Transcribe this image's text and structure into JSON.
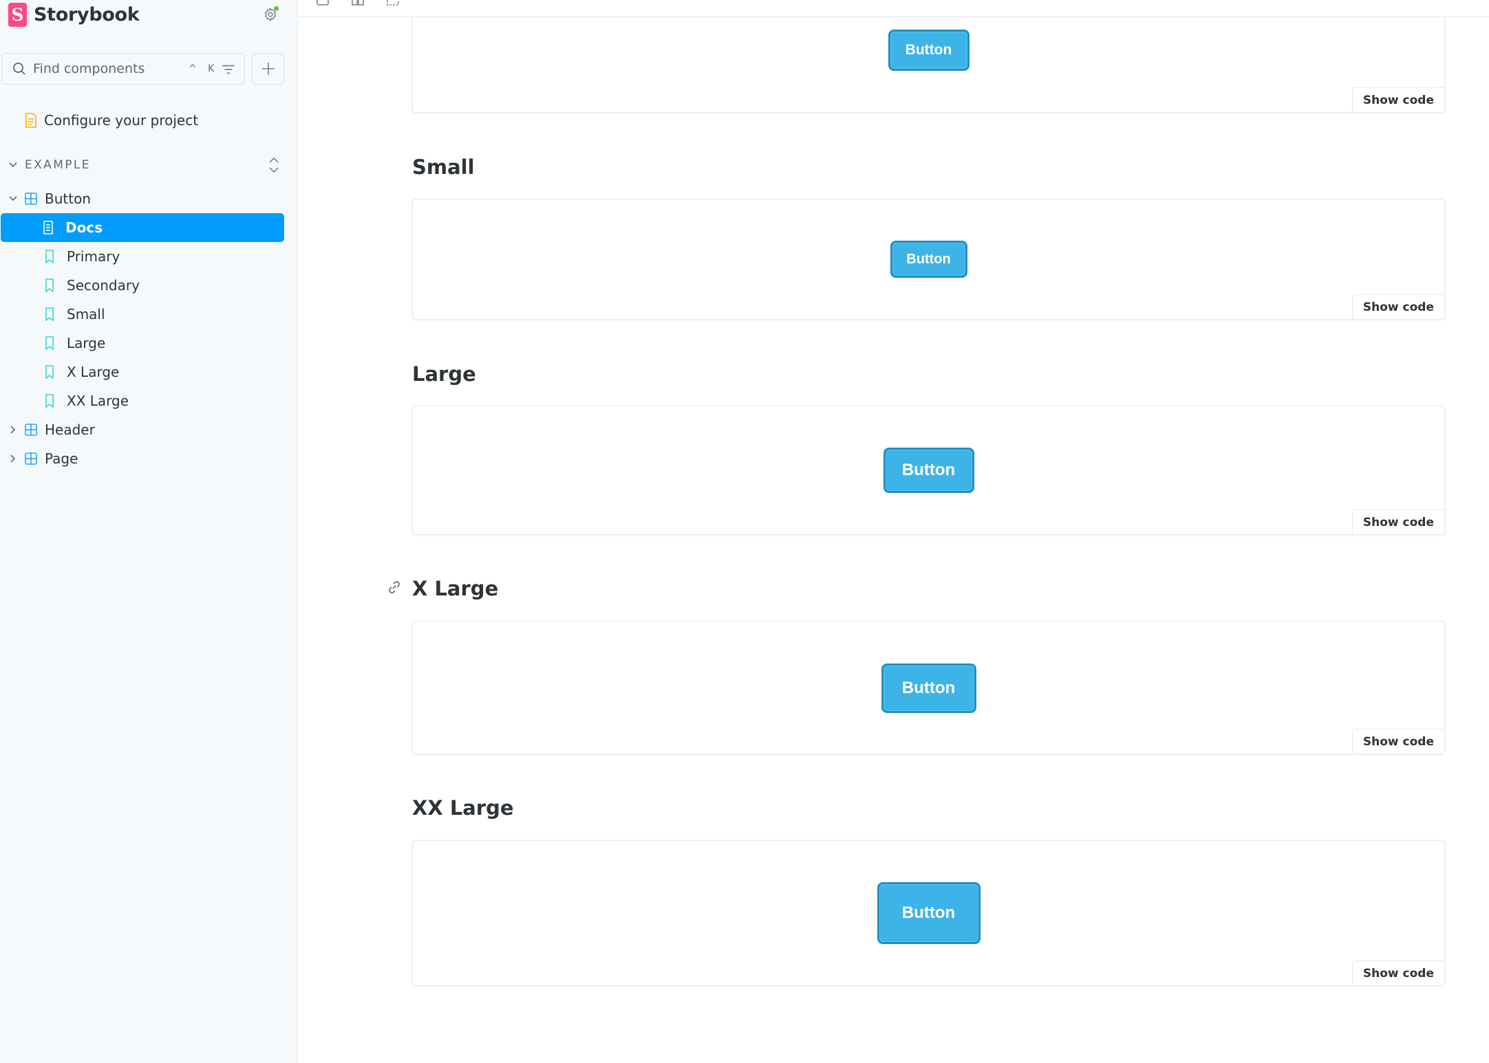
{
  "brand": {
    "name": "Storybook",
    "logo_letter": "S"
  },
  "search": {
    "placeholder": "Find components",
    "shortcut": "^ K"
  },
  "sidebar": {
    "configure_label": "Configure your project",
    "group_label": "EXAMPLE",
    "button_component": "Button",
    "items": [
      {
        "label": "Docs"
      },
      {
        "label": "Primary"
      },
      {
        "label": "Secondary"
      },
      {
        "label": "Small"
      },
      {
        "label": "Large"
      },
      {
        "label": "X Large"
      },
      {
        "label": "XX Large"
      }
    ],
    "header_component": "Header",
    "page_component": "Page"
  },
  "stories": [
    {
      "title": "",
      "button_label": "Button",
      "show_code": "Show code"
    },
    {
      "title": "Small",
      "button_label": "Button",
      "show_code": "Show code"
    },
    {
      "title": "Large",
      "button_label": "Button",
      "show_code": "Show code"
    },
    {
      "title": "X Large",
      "button_label": "Button",
      "show_code": "Show code"
    },
    {
      "title": "XX Large",
      "button_label": "Button",
      "show_code": "Show code"
    }
  ],
  "colors": {
    "accent": "#029cfd",
    "brand": "#ff4785",
    "demo_button": "#3db4e8",
    "component_icon": "#1ea7fd",
    "story_icon": "#37d5d3",
    "doc_icon": "#ffae00"
  }
}
